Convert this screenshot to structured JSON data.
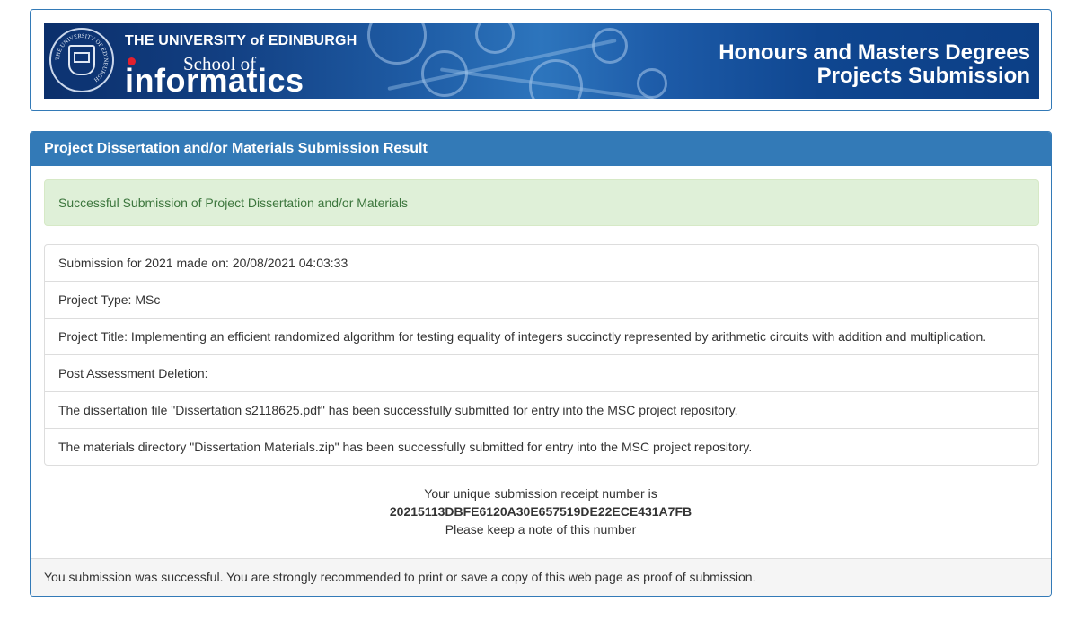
{
  "header": {
    "university_name": "THE UNIVERSITY of EDINBURGH",
    "school_of": "School of",
    "school_name": "informatics",
    "title_line1": "Honours and Masters Degrees",
    "title_line2": "Projects Submission",
    "seal_icon": "university-seal-icon",
    "seal_ring_text": "THE UNIVERSITY OF EDINBURGH"
  },
  "panel": {
    "heading": "Project Dissertation and/or Materials Submission Result",
    "alert": "Successful Submission of Project Dissertation and/or Materials",
    "items": [
      "Submission for 2021 made on: 20/08/2021 04:03:33",
      "Project Type: MSc",
      "Project Title: Implementing an efficient randomized algorithm for testing equality of integers succinctly represented by arithmetic circuits with addition and multiplication.",
      "Post Assessment Deletion:",
      "The dissertation file \"Dissertation s2118625.pdf\" has been successfully submitted for entry into the MSC project repository.",
      "The materials directory \"Dissertation Materials.zip\" has been successfully submitted for entry into the MSC project repository."
    ],
    "receipt_intro": "Your unique submission receipt number is",
    "receipt_number": "20215113DBFE6120A30E657519DE22ECE431A7FB",
    "receipt_note": "Please keep a note of this number",
    "footer": "You submission was successful. You are strongly recommended to print or save a copy of this web page as proof of submission."
  },
  "colors": {
    "primary": "#337ab7",
    "success_bg": "#dff0d8",
    "success_text": "#3c763d",
    "accent_red": "#e0202e"
  }
}
